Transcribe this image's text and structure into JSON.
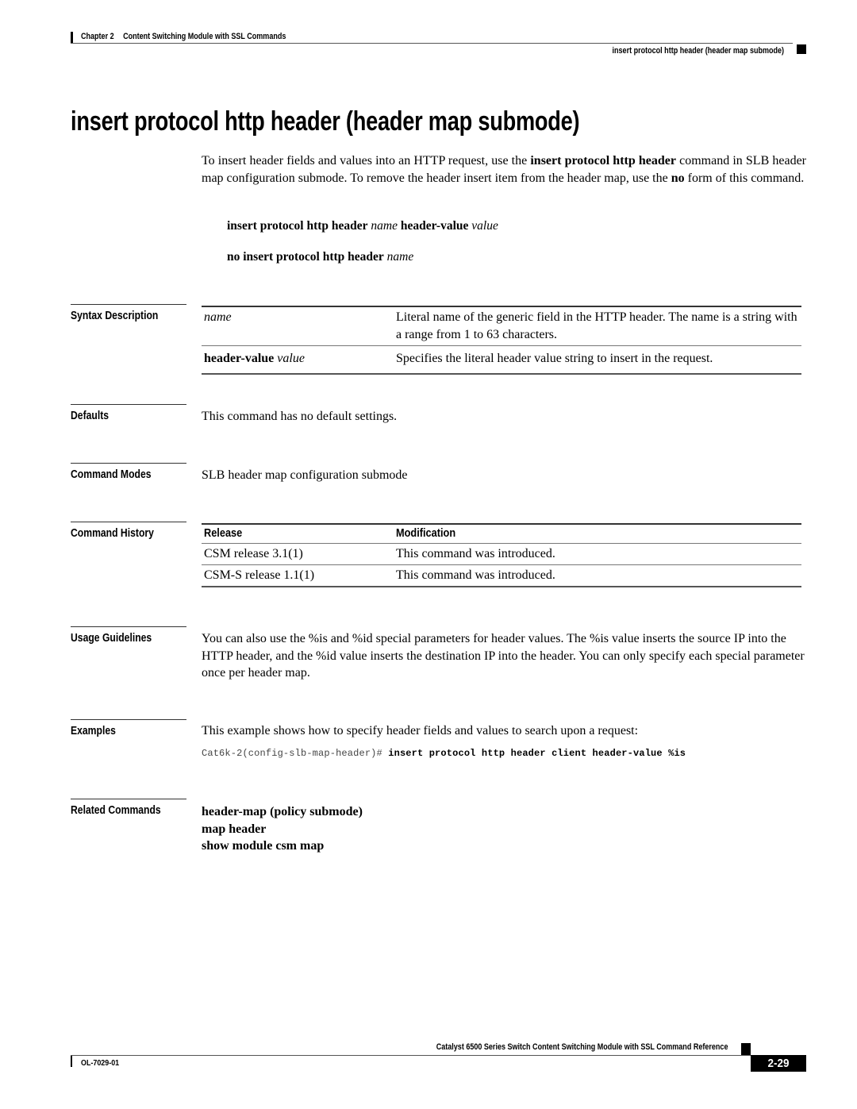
{
  "header": {
    "chapter_label": "Chapter 2",
    "chapter_title": "Content Switching Module with SSL Commands",
    "section": "insert protocol http header (header map submode)"
  },
  "title": "insert protocol http header (header map submode)",
  "intro": {
    "p1": "To insert header fields and values into an HTTP request, use the ",
    "cmd": "insert protocol http header",
    "p2": " command in SLB header map configuration submode. To remove the header insert item from the header map, use the ",
    "no": "no",
    "p3": " form of this command."
  },
  "syntax": {
    "line1": {
      "kw1": "insert protocol http header",
      "arg1": "name",
      "kw2": "header-value",
      "arg2": "value"
    },
    "line2": {
      "kw1": "no insert protocol http header",
      "arg1": "name"
    }
  },
  "sections": {
    "syntax_description": "Syntax Description",
    "defaults": "Defaults",
    "command_modes": "Command Modes",
    "command_history": "Command History",
    "usage_guidelines": "Usage Guidelines",
    "examples": "Examples",
    "related_commands": "Related Commands"
  },
  "syntax_description": [
    {
      "kw": "",
      "arg": "name",
      "desc": "Literal name of the generic field in the HTTP header. The name is a string with a range from 1 to 63 characters."
    },
    {
      "kw": "header-value",
      "arg": "value",
      "desc": "Specifies the literal header value string to insert in the request."
    }
  ],
  "defaults": "This command has no default settings.",
  "command_modes": "SLB header map configuration submode",
  "command_history": {
    "headers": [
      "Release",
      "Modification"
    ],
    "rows": [
      [
        "CSM release 3.1(1)",
        "This command was introduced."
      ],
      [
        "CSM-S release 1.1(1)",
        "This command was introduced."
      ]
    ]
  },
  "usage_guidelines": "You can also use the %is and %id special parameters for header values. The %is value inserts the source IP into the HTTP header, and the %id value inserts the destination IP into the header. You can only specify each special parameter once per header map.",
  "examples": {
    "text": "This example shows how to specify header fields and values to search upon a request:",
    "prompt": "Cat6k-2(config-slb-map-header)# ",
    "command": "insert protocol http header client header-value %is"
  },
  "related_commands": [
    "header-map (policy submode)",
    "map header",
    "show module csm map"
  ],
  "footer": {
    "book_title": "Catalyst 6500 Series Switch Content Switching Module with SSL Command Reference",
    "doc_number": "OL-7029-01",
    "page_number": "2-29"
  }
}
